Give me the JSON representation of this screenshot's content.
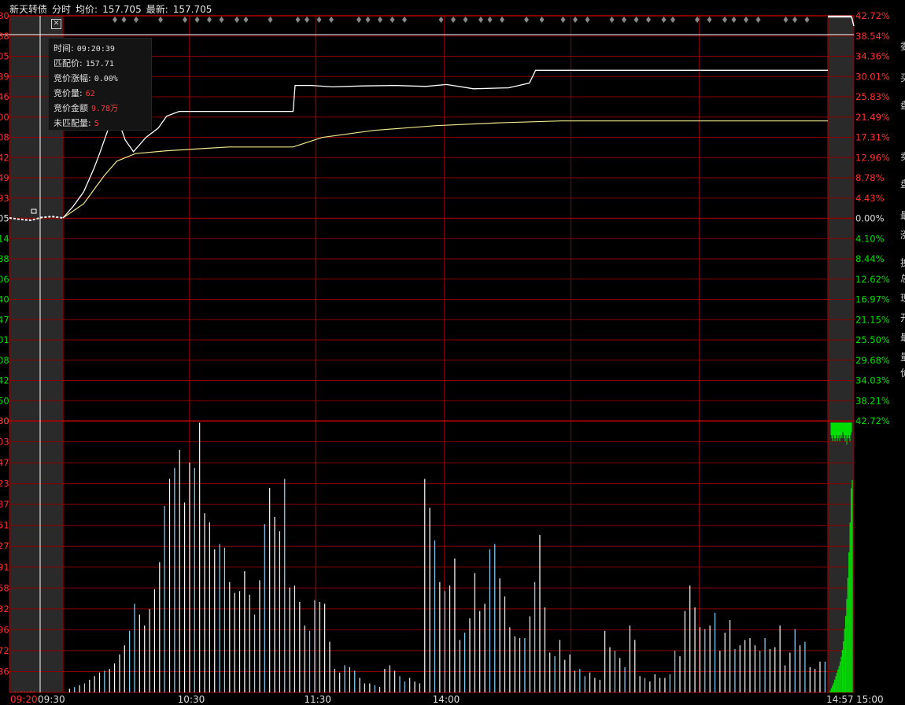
{
  "header": {
    "name": "新天转债",
    "mode": "分时",
    "avg_label": "均价:",
    "avg_value": "157.705",
    "last_label": "最新:",
    "last_value": "157.705"
  },
  "popup": {
    "rows": [
      {
        "label": "时间:",
        "value": "09:20:39",
        "red": false
      },
      {
        "label": "匹配价:",
        "value": "157.71",
        "red": false
      },
      {
        "label": "竞价涨幅:",
        "value": "0.00%",
        "red": false
      },
      {
        "label": "竞价量:",
        "value": "62",
        "red": true
      },
      {
        "label": "竞价金额",
        "value": "9.78万",
        "red": true
      },
      {
        "label": "未匹配量:",
        "value": "5",
        "red": true
      }
    ]
  },
  "colors": {
    "grid": "#8b0000",
    "up": "#ff3030",
    "down": "#00e000",
    "price_line": "#ffffff",
    "avg_line": "#f0e68c",
    "volume_cyan": "#8fd8ff",
    "panel_shade": "#3a3a3a"
  },
  "right_panel_glyphs": [
    "委",
    "买",
    "盘",
    "卖",
    "盘",
    "最",
    "涨",
    "换",
    "总",
    "现",
    "开",
    "最",
    "量",
    "价"
  ],
  "chart_data": {
    "type": "line",
    "title": "新天转债 分时",
    "base_price": 157.705,
    "y_ticks_right": [
      "42.72%",
      "38.54%",
      "34.36%",
      "30.01%",
      "25.83%",
      "21.49%",
      "17.31%",
      "12.96%",
      "8.78%",
      "4.43%",
      "0.00%",
      "4.10%",
      "8.44%",
      "12.62%",
      "16.97%",
      "21.15%",
      "25.50%",
      "29.68%",
      "34.03%",
      "38.21%",
      "42.72%"
    ],
    "y_ticks_left_clipped": [
      "80",
      "88",
      "05",
      "89",
      "46",
      "00",
      "08",
      "42",
      "49",
      "93",
      "05",
      "14",
      "88",
      "06",
      "40",
      "47",
      "01",
      "08",
      "42",
      "50",
      "80"
    ],
    "y_tick_up_count": 10,
    "volume_left_clipped": [
      "80",
      "03",
      "47",
      "23",
      "87",
      "51",
      "27",
      "91",
      "58",
      "32",
      "96",
      "72",
      "36"
    ],
    "x_ticks": [
      "09:20",
      "09:30",
      "10:30",
      "11:30",
      "14:00",
      "14:57",
      "15:00"
    ],
    "price_pct": {
      "auction": [
        [
          0,
          0
        ],
        [
          0.2,
          -0.3
        ],
        [
          0.4,
          -0.5
        ],
        [
          0.6,
          0.1
        ],
        [
          0.8,
          0.3
        ],
        [
          1,
          0
        ]
      ],
      "session": [
        [
          0,
          0
        ],
        [
          5,
          2.5
        ],
        [
          10,
          5.5
        ],
        [
          15,
          10.5
        ],
        [
          18,
          14
        ],
        [
          22,
          19
        ],
        [
          26,
          21.5
        ],
        [
          30,
          16.5
        ],
        [
          34,
          14
        ],
        [
          40,
          17
        ],
        [
          46,
          19
        ],
        [
          50,
          21.5
        ],
        [
          56,
          22.5
        ],
        [
          80,
          22.5
        ],
        [
          100,
          22.5
        ],
        [
          111,
          22.5
        ],
        [
          112,
          28
        ],
        [
          120,
          28
        ],
        [
          130,
          27.7
        ],
        [
          145,
          27.9
        ],
        [
          160,
          28
        ],
        [
          175,
          27.8
        ],
        [
          185,
          28.2
        ],
        [
          198,
          27.3
        ],
        [
          215,
          27.5
        ],
        [
          225,
          28.5
        ],
        [
          228,
          31.2
        ],
        [
          245,
          31.2
        ],
        [
          290,
          31.2
        ],
        [
          330,
          31.2
        ],
        [
          369,
          31.2
        ]
      ]
    },
    "avg_pct": [
      [
        0,
        0
      ],
      [
        5,
        1.5
      ],
      [
        10,
        3
      ],
      [
        15,
        6
      ],
      [
        20,
        9
      ],
      [
        26,
        12
      ],
      [
        35,
        13.6
      ],
      [
        50,
        14.2
      ],
      [
        80,
        15
      ],
      [
        111,
        15
      ],
      [
        125,
        17
      ],
      [
        150,
        18.5
      ],
      [
        180,
        19.5
      ],
      [
        210,
        20.1
      ],
      [
        240,
        20.5
      ],
      [
        300,
        20.5
      ],
      [
        369,
        20.5
      ]
    ],
    "volume_left": [
      0.2,
      0.4,
      0.3,
      0.6,
      0.5,
      0.5,
      0.7,
      0.5
    ],
    "volume_session": [
      0,
      2,
      3,
      4,
      5,
      7,
      9,
      11,
      12,
      13,
      16,
      21,
      26,
      34,
      49,
      43,
      37,
      46,
      57,
      72,
      103,
      118,
      124,
      134,
      105,
      127,
      124,
      149,
      99,
      94,
      79,
      82,
      80,
      61,
      55,
      56,
      67,
      54,
      43,
      62,
      93,
      113,
      97,
      89,
      118,
      58,
      59,
      50,
      37,
      34,
      51,
      50,
      49,
      28,
      13,
      11,
      15,
      14,
      12,
      8,
      5,
      5,
      4,
      3,
      13,
      15,
      12,
      9,
      6,
      8,
      6,
      5,
      118,
      102,
      84,
      61,
      56,
      59,
      74,
      29,
      33,
      41,
      66,
      45,
      49,
      79,
      82,
      63,
      53,
      36,
      31,
      30,
      30,
      42,
      61,
      87,
      47,
      22,
      20,
      29,
      18,
      21,
      12,
      13,
      9,
      11,
      8,
      7,
      34,
      25,
      23,
      19,
      14,
      37,
      29,
      9,
      8,
      6,
      10,
      8,
      8,
      10,
      23,
      20,
      45,
      59,
      47,
      36,
      35,
      37,
      44,
      23,
      33,
      40,
      24,
      26,
      29,
      30,
      26,
      23,
      30,
      24,
      25,
      37,
      15,
      22,
      35,
      26,
      28,
      14,
      13,
      17,
      17,
      24,
      28,
      32,
      37,
      22,
      55,
      46,
      19,
      58,
      52,
      29,
      41,
      35,
      54,
      63,
      16,
      11,
      13,
      12,
      10,
      14,
      32,
      26,
      29,
      45,
      37,
      10,
      12,
      12,
      7,
      8,
      7,
      12,
      19,
      15,
      20,
      11,
      12,
      9,
      13,
      13,
      21,
      34,
      33,
      18,
      22,
      28,
      23,
      29,
      31,
      21,
      13,
      14,
      18,
      14,
      17,
      19,
      13,
      25,
      29,
      13,
      23,
      38,
      35,
      20,
      26,
      8,
      23,
      28,
      24,
      23,
      44,
      54,
      12,
      11,
      46,
      53,
      19,
      18,
      30,
      34,
      9,
      10
    ],
    "volume_close": [
      2,
      5,
      8,
      11,
      15,
      19,
      23,
      27,
      31,
      36,
      42,
      50,
      60,
      75,
      90,
      110,
      135,
      165,
      200,
      240,
      250
    ],
    "auction_tail_bars": [
      4,
      5,
      6,
      4,
      5,
      6,
      5,
      4,
      6,
      5,
      4,
      6,
      5,
      4,
      5,
      3,
      4,
      5,
      6,
      4,
      7,
      5,
      4,
      5,
      6,
      4,
      3
    ]
  }
}
